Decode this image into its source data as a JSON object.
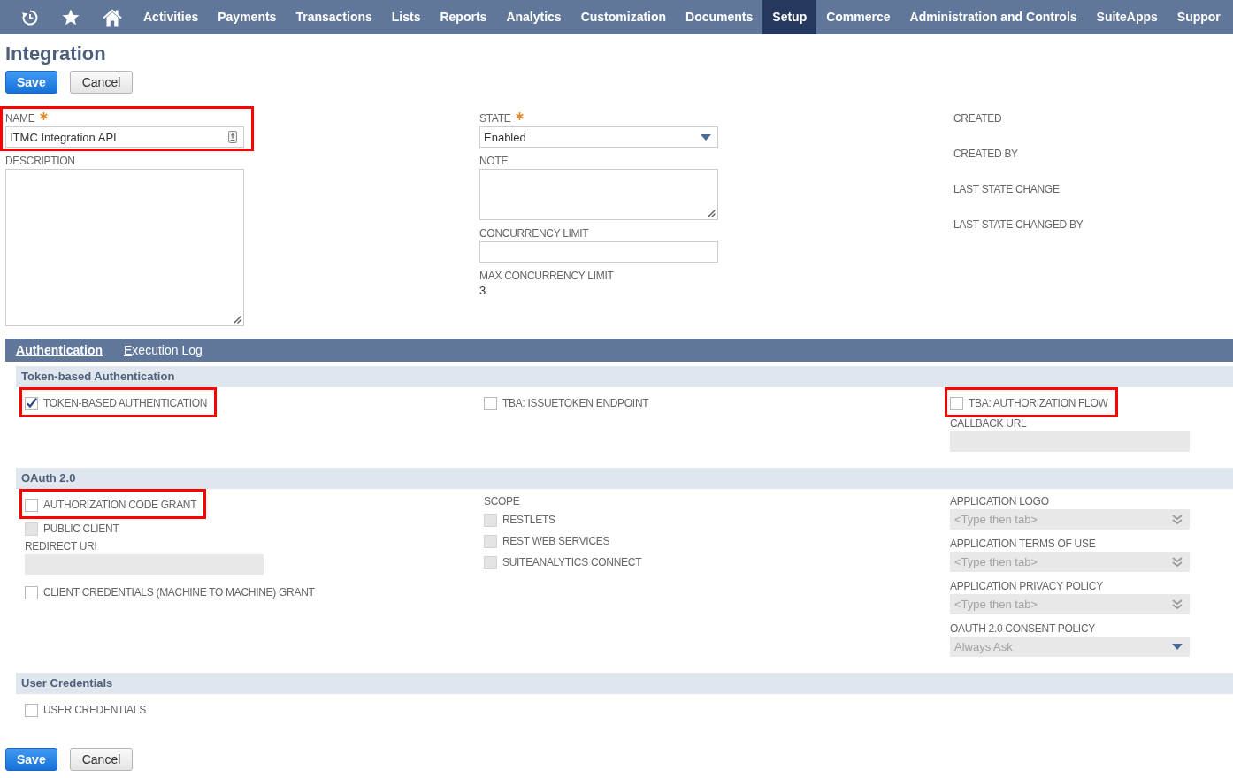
{
  "nav": {
    "items": [
      {
        "label": "Activities",
        "selected": false
      },
      {
        "label": "Payments",
        "selected": false
      },
      {
        "label": "Transactions",
        "selected": false
      },
      {
        "label": "Lists",
        "selected": false
      },
      {
        "label": "Reports",
        "selected": false
      },
      {
        "label": "Analytics",
        "selected": false
      },
      {
        "label": "Customization",
        "selected": false
      },
      {
        "label": "Documents",
        "selected": false
      },
      {
        "label": "Setup",
        "selected": true
      },
      {
        "label": "Commerce",
        "selected": false
      },
      {
        "label": "Administration and Controls",
        "selected": false
      },
      {
        "label": "SuiteApps",
        "selected": false
      },
      {
        "label": "Suppor",
        "selected": false
      }
    ]
  },
  "page_title": "Integration",
  "top_buttons": [
    {
      "label": "Save",
      "kind": "save"
    },
    {
      "label": "Cancel",
      "kind": "cancel"
    }
  ],
  "main_form": {
    "columns": [
      [
        {
          "kind": "text",
          "label": "NAME",
          "required": true,
          "disabled": false,
          "highlighted": true,
          "value": "ITMC Integration API"
        },
        {
          "kind": "long_text",
          "label": "DESCRIPTION",
          "required": false,
          "disabled": false,
          "highlighted": false
        }
      ],
      [
        {
          "kind": "select",
          "label": "STATE",
          "required": true,
          "disabled": false,
          "highlighted": false,
          "value": "Enabled"
        },
        {
          "kind": "textarea",
          "label": "NOTE",
          "required": false,
          "disabled": false,
          "highlighted": false
        },
        {
          "kind": "integer",
          "label": "CONCURRENCY LIMIT",
          "required": false,
          "disabled": false,
          "highlighted": false
        },
        {
          "kind": "readonly",
          "label": "MAX CONCURRENCY LIMIT",
          "required": false,
          "highlighted": false,
          "value": "3"
        }
      ],
      [
        {
          "kind": "readonly",
          "label": "CREATED",
          "required": false,
          "highlighted": false
        },
        {
          "kind": "readonly",
          "label": "CREATED BY",
          "required": false,
          "highlighted": false
        },
        {
          "kind": "readonly",
          "label": "LAST STATE CHANGE",
          "required": false,
          "highlighted": false
        },
        {
          "kind": "readonly",
          "label": "LAST STATE CHANGED BY",
          "required": false,
          "highlighted": false
        }
      ]
    ]
  },
  "subtabs": [
    {
      "label": "Authentication",
      "selected": true
    },
    {
      "label": "Execution Log",
      "selected": false
    }
  ],
  "sections": [
    {
      "title": "Token-based Authentication",
      "columns": [
        [
          {
            "kind": "checkbox",
            "label": "TOKEN-BASED AUTHENTICATION",
            "checked": true,
            "disabled": false,
            "highlighted": true
          }
        ],
        [
          {
            "kind": "checkbox",
            "label": "TBA: ISSUETOKEN ENDPOINT",
            "checked": false,
            "disabled": false,
            "highlighted": false
          }
        ],
        [
          {
            "kind": "checkbox",
            "label": "TBA: AUTHORIZATION FLOW",
            "checked": false,
            "disabled": false,
            "highlighted": true
          },
          {
            "kind": "url",
            "label": "CALLBACK URL",
            "required": false,
            "disabled": true,
            "highlighted": false
          }
        ]
      ]
    },
    {
      "title": "OAuth 2.0",
      "columns": [
        [
          {
            "kind": "checkbox",
            "label": "AUTHORIZATION CODE GRANT",
            "checked": false,
            "disabled": false,
            "highlighted": true
          },
          {
            "kind": "checkbox",
            "label": "PUBLIC CLIENT",
            "checked": false,
            "disabled": true,
            "highlighted": false
          },
          {
            "kind": "url",
            "label": "REDIRECT URI",
            "required": false,
            "disabled": true,
            "highlighted": false
          },
          {
            "kind": "checkbox",
            "label": "CLIENT CREDENTIALS (MACHINE TO MACHINE) GRANT",
            "checked": false,
            "disabled": false,
            "highlighted": false
          }
        ],
        [
          {
            "kind": "heading",
            "label": "SCOPE",
            "highlighted": false
          },
          {
            "kind": "checkbox",
            "label": "RESTLETS",
            "checked": false,
            "disabled": true,
            "highlighted": false
          },
          {
            "kind": "checkbox",
            "label": "REST WEB SERVICES",
            "checked": false,
            "disabled": true,
            "highlighted": false
          },
          {
            "kind": "checkbox",
            "label": "SUITEANALYTICS CONNECT",
            "checked": false,
            "disabled": true,
            "highlighted": false
          }
        ],
        [
          {
            "kind": "combo",
            "label": "APPLICATION LOGO",
            "required": false,
            "disabled": true,
            "highlighted": false,
            "placeholder": "<Type then tab>"
          },
          {
            "kind": "combo",
            "label": "APPLICATION TERMS OF USE",
            "required": false,
            "disabled": true,
            "highlighted": false,
            "placeholder": "<Type then tab>"
          },
          {
            "kind": "combo",
            "label": "APPLICATION PRIVACY POLICY",
            "required": false,
            "disabled": true,
            "highlighted": false,
            "placeholder": "<Type then tab>"
          },
          {
            "kind": "select",
            "label": "OAUTH 2.0 CONSENT POLICY",
            "required": false,
            "disabled": true,
            "highlighted": false,
            "value": "Always Ask"
          }
        ]
      ]
    },
    {
      "title": "User Credentials",
      "columns": [
        [
          {
            "kind": "checkbox",
            "label": "USER CREDENTIALS",
            "checked": false,
            "disabled": false,
            "highlighted": false
          }
        ]
      ]
    }
  ],
  "bottom_buttons": [
    {
      "label": "Save",
      "kind": "save"
    },
    {
      "label": "Cancel",
      "kind": "cancel"
    }
  ]
}
